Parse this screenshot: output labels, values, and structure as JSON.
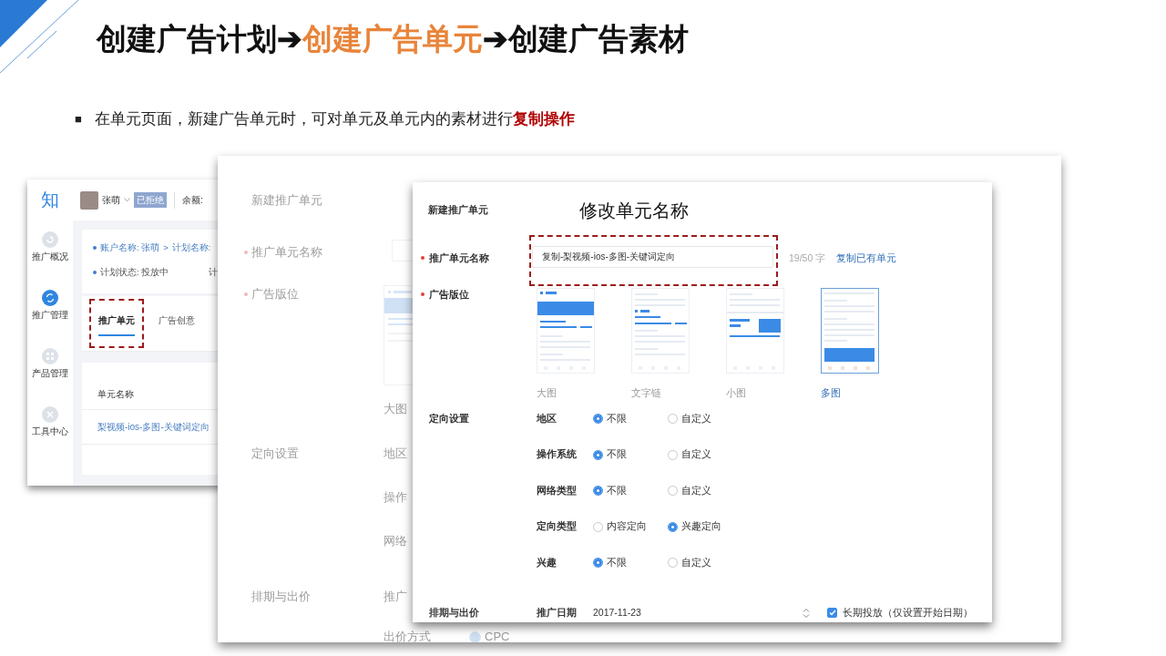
{
  "title": {
    "parts": [
      {
        "kind": "step",
        "text": "创建广告计划",
        "current": false
      },
      {
        "kind": "arrow",
        "text": "➔"
      },
      {
        "kind": "step",
        "text": "创建广告单元",
        "current": true
      },
      {
        "kind": "arrow",
        "text": "➔"
      },
      {
        "kind": "step",
        "text": "创建广告素材",
        "current": false
      }
    ]
  },
  "bullet": {
    "marker": "■",
    "text": "在单元页面，新建广告单元时，可对单元及单元内的素材进行**复制操作**"
  },
  "console": {
    "logo": "知",
    "user": {
      "name": "张萌",
      "status": "已拒绝"
    },
    "balance_label": "余额:",
    "sidebar": {
      "items": [
        {
          "label": "推广概况",
          "selected": false
        },
        {
          "label": "推广管理",
          "selected": true
        },
        {
          "label": "产品管理",
          "selected": false
        },
        {
          "label": "工具中心",
          "selected": false
        }
      ]
    },
    "info": {
      "lines": [
        {
          "parts": [
            "账户名称: 张萌",
            ">",
            "计划名称:"
          ],
          "link": true
        },
        {
          "parts": [
            "计划状态: 投放中",
            "计"
          ],
          "link": false
        }
      ]
    },
    "tabs": [
      {
        "label": "推广单元",
        "selected": true,
        "callout": true
      },
      {
        "label": "广告创意",
        "selected": false,
        "callout": false
      }
    ],
    "table": {
      "columns": [
        "单元名称"
      ],
      "rows": [
        [
          "梨视频-ios-多图-关键词定向"
        ]
      ]
    }
  },
  "ghost_dialog": {
    "title": "新建推广单元",
    "sections": [
      {
        "kind": "input",
        "label": "推广单元名称",
        "required": true
      },
      {
        "kind": "placement",
        "label": "广告版位",
        "required": true,
        "caption": "大图"
      },
      {
        "kind": "targeting",
        "label": "定向设置",
        "required": false,
        "items": [
          {
            "label": "地区"
          },
          {
            "label": "操作"
          },
          {
            "label": "网络"
          }
        ]
      },
      {
        "kind": "schedule",
        "label": "排期与出价",
        "required": false,
        "items": [
          {
            "label": "推广"
          },
          {
            "label": "出价方式",
            "option": {
              "label": "CPC",
              "selected": true
            }
          }
        ]
      }
    ]
  },
  "dialog": {
    "title": "新建推广单元",
    "annotation": "修改单元名称",
    "name_field": {
      "label": "推广单元名称",
      "required": true,
      "value": "复制-梨视频-ios-多图-关键词定向",
      "callout": true,
      "counter": "19/50 字",
      "link": "复制已有单元"
    },
    "placement": {
      "label": "广告版位",
      "required": true,
      "options": [
        {
          "kind": "large",
          "label": "大图",
          "selected": false
        },
        {
          "kind": "text",
          "label": "文字链",
          "selected": false
        },
        {
          "kind": "small",
          "label": "小图",
          "selected": false
        },
        {
          "kind": "multi",
          "label": "多图",
          "selected": true
        }
      ]
    },
    "targeting": {
      "label": "定向设置",
      "rows": [
        {
          "label": "地区",
          "options": [
            {
              "label": "不限",
              "selected": true
            },
            {
              "label": "自定义",
              "selected": false
            }
          ]
        },
        {
          "label": "操作系统",
          "options": [
            {
              "label": "不限",
              "selected": true
            },
            {
              "label": "自定义",
              "selected": false
            }
          ]
        },
        {
          "label": "网络类型",
          "options": [
            {
              "label": "不限",
              "selected": true
            },
            {
              "label": "自定义",
              "selected": false
            }
          ]
        },
        {
          "label": "定向类型",
          "options": [
            {
              "label": "内容定向",
              "selected": false
            },
            {
              "label": "兴趣定向",
              "selected": true
            }
          ]
        },
        {
          "label": "兴趣",
          "options": [
            {
              "label": "不限",
              "selected": true
            },
            {
              "label": "自定义",
              "selected": false
            }
          ]
        }
      ]
    },
    "schedule": {
      "label": "排期与出价",
      "date_label": "推广日期",
      "date": "2017-11-23",
      "long_term": {
        "label": "长期投放（仅设置开始日期）",
        "checked": true
      }
    }
  }
}
